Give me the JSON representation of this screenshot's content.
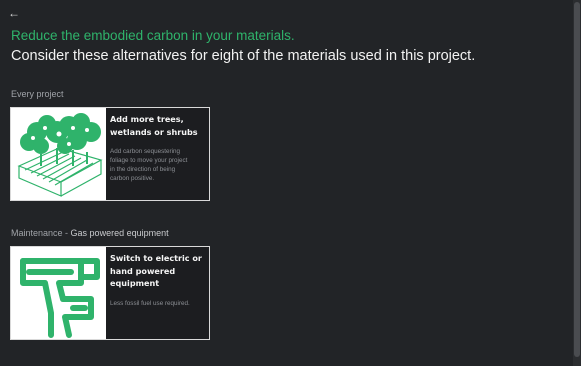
{
  "nav": {
    "back_icon": "arrow-left-icon",
    "back_glyph": "←"
  },
  "header": {
    "headline": "Reduce the embodied carbon in your materials.",
    "subhead": "Consider these alternatives for eight of the materials used in this project."
  },
  "colors": {
    "accent": "#2fb36b",
    "background": "#222427",
    "card_bg": "#1c1d20"
  },
  "sections": [
    {
      "label": "Every project",
      "cards": [
        {
          "icon": "trees-wetlands-icon",
          "title_lines": [
            "Add more trees,",
            "wetlands or shrubs"
          ],
          "description_lines": [
            "Add carbon sequestering",
            "foliage to move your project",
            "in the direction of being",
            "carbon positive."
          ]
        }
      ]
    },
    {
      "label_prefix": "Maintenance - ",
      "label_emphasis": "Gas powered equipment",
      "cards": [
        {
          "icon": "power-drill-icon",
          "title_lines": [
            "Switch to electric or",
            "hand powered",
            "equipment"
          ],
          "description_lines": [
            "Less fossil fuel use required."
          ]
        }
      ]
    }
  ]
}
